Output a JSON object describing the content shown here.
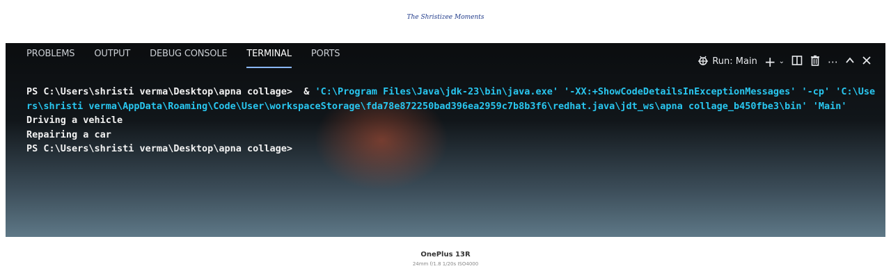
{
  "watermark": {
    "script_text": "The Shristizee Moments"
  },
  "panel": {
    "tabs": [
      {
        "label": "PROBLEMS"
      },
      {
        "label": "OUTPUT"
      },
      {
        "label": "DEBUG CONSOLE"
      },
      {
        "label": "TERMINAL"
      },
      {
        "label": "PORTS"
      }
    ],
    "active_tab": "TERMINAL",
    "run_label": "Run: Main",
    "icons": [
      "debug-run-icon",
      "plus-icon",
      "chevron-down-icon",
      "split-terminal-icon",
      "trash-icon",
      "more-icon",
      "chevron-up-icon",
      "close-icon"
    ]
  },
  "terminal": {
    "prompt1": "PS C:\\Users\\shristi verma\\Desktop\\apna collage> ",
    "amp": " & ",
    "command": "'C:\\Program Files\\Java\\jdk-23\\bin\\java.exe' '-XX:+ShowCodeDetailsInExceptionMessages' '-cp' 'C:\\Users\\shristi verma\\AppData\\Roaming\\Code\\User\\workspaceStorage\\fda78e872250bad396ea2959c7b8b3f6\\redhat.java\\jdt_ws\\apna collage_b450fbe3\\bin' 'Main'",
    "output1": "Driving a vehicle",
    "output2": "Repairing a car",
    "prompt2": "PS C:\\Users\\shristi verma\\Desktop\\apna collage>"
  },
  "caption": {
    "model": "OnePlus 13R",
    "specs": "24mm  f/1.8  1/20s  ISO4000"
  },
  "colors": {
    "accent": "#29c7f0",
    "tab_underline": "#8ab8ff"
  }
}
